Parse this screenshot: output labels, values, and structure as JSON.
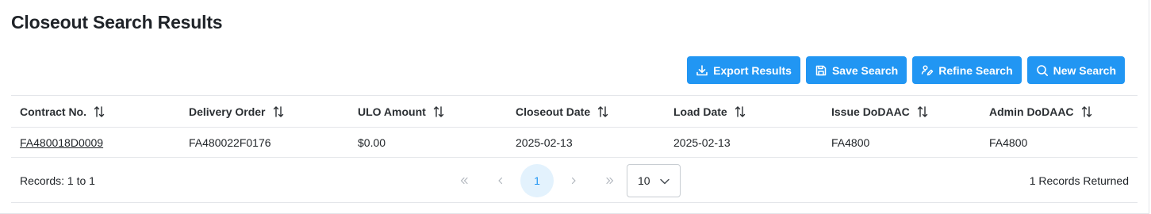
{
  "page": {
    "title": "Closeout Search Results"
  },
  "toolbar": {
    "buttons": [
      {
        "label": "Export Results",
        "icon": "download-icon"
      },
      {
        "label": "Save Search",
        "icon": "save-icon"
      },
      {
        "label": "Refine Search",
        "icon": "edit-icon"
      },
      {
        "label": "New Search",
        "icon": "search-icon"
      }
    ]
  },
  "table": {
    "columns": [
      "Contract No.",
      "Delivery Order",
      "ULO Amount",
      "Closeout Date",
      "Load Date",
      "Issue DoDAAC",
      "Admin DoDAAC"
    ],
    "rows": [
      [
        "FA480018D0009",
        "FA480022F0176",
        "$0.00",
        "2025-02-13",
        "2025-02-13",
        "FA4800",
        "FA4800"
      ]
    ]
  },
  "footer": {
    "records": "Records: 1 to 1",
    "current_page": "1",
    "rows_per_page": "10",
    "returned": "1 Records Returned"
  },
  "colors": {
    "primary": "#2196f3",
    "border": "#e4e6ea",
    "page_active_bg": "#e3f2fd"
  }
}
